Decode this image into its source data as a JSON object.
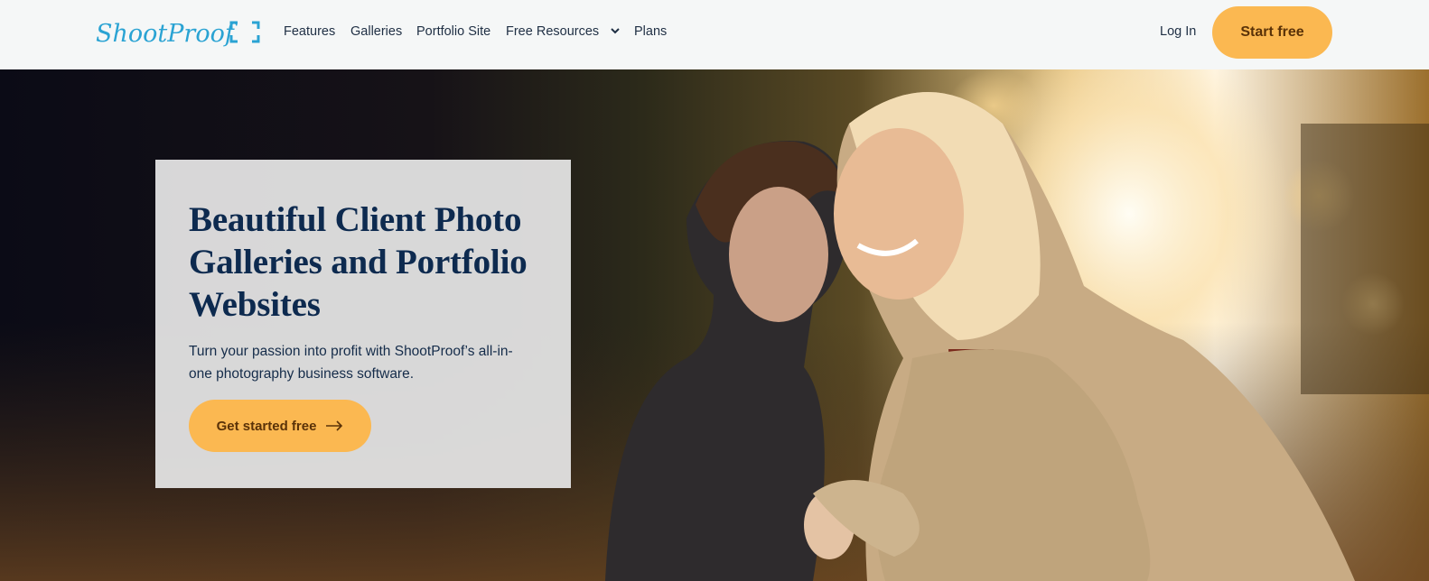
{
  "header": {
    "logo_text": "ShootProof",
    "nav": [
      {
        "label": "Features"
      },
      {
        "label": "Galleries"
      },
      {
        "label": "Portfolio Site"
      },
      {
        "label": "Free Resources",
        "has_dropdown": true
      },
      {
        "label": "Plans"
      }
    ],
    "login_label": "Log In",
    "start_label": "Start free"
  },
  "hero": {
    "title": "Beautiful Client Photo Galleries and Portfolio Websites",
    "subtitle": "Turn your passion into profit with ShootProof’s all-in-one photography business software.",
    "cta_label": "Get started free",
    "cta_icon": "arrow-right-icon",
    "image_alt": "Mother smiling as her son kisses her cheek in a sunlit golden field"
  },
  "colors": {
    "brand_blue": "#2aa3d3",
    "accent_orange": "#fbb851",
    "button_text": "#5a3208",
    "heading_navy": "#0d2a4f",
    "header_bg": "#f5f7f7"
  }
}
